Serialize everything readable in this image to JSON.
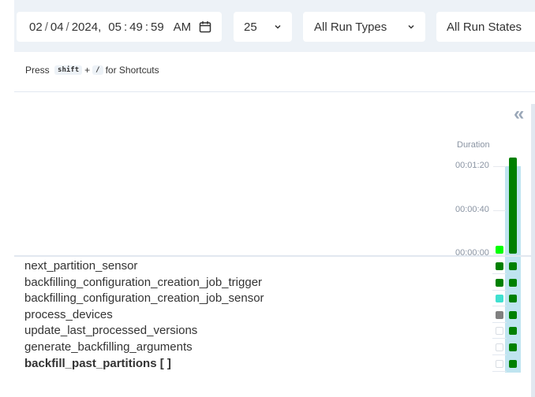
{
  "filters": {
    "date": {
      "month": "02",
      "day": "04",
      "year": "2024",
      "hour": "05",
      "minute": "49",
      "second": "59",
      "ampm": "AM"
    },
    "page_size": "25",
    "run_types": "All Run Types",
    "run_states": "All Run States"
  },
  "shortcuts": {
    "prefix": "Press",
    "key1": "shift",
    "plus": "+",
    "key2": "/",
    "suffix": "for Shortcuts"
  },
  "grid": {
    "collapse_glyph": "«",
    "duration_title": "Duration",
    "ticks": [
      "00:01:20",
      "00:00:40",
      "00:00:00"
    ],
    "runs": [
      {
        "duration_seconds": 3,
        "color": "#00ff00"
      },
      {
        "duration_seconds": 88,
        "color": "#008000"
      }
    ],
    "tasks": [
      {
        "name": "next_partition_sensor",
        "bold": false,
        "states": [
          "#008000",
          "#008000"
        ]
      },
      {
        "name": "backfilling_configuration_creation_job_trigger",
        "bold": false,
        "states": [
          "#008000",
          "#008000"
        ]
      },
      {
        "name": "backfilling_configuration_creation_job_sensor",
        "bold": false,
        "states": [
          "#40e0d0",
          "#008000"
        ]
      },
      {
        "name": "process_devices",
        "bold": false,
        "states": [
          "#808080",
          "#008000"
        ]
      },
      {
        "name": "update_last_processed_versions",
        "bold": false,
        "states": [
          null,
          "#008000"
        ]
      },
      {
        "name": "generate_backfilling_arguments",
        "bold": false,
        "states": [
          null,
          "#008000"
        ]
      },
      {
        "name": "backfill_past_partitions [ ]",
        "bold": true,
        "states": [
          null,
          "#008000"
        ]
      }
    ]
  }
}
